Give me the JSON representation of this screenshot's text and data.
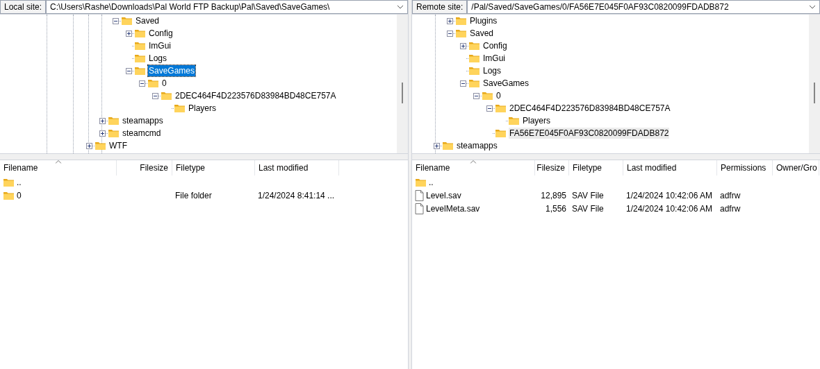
{
  "local": {
    "label": "Local site:",
    "path": "C:\\Users\\Rashe\\Downloads\\Pal World FTP Backup\\Pal\\Saved\\SaveGames\\",
    "tree": {
      "items": [
        {
          "children": [
            {
              "children": [
                {
                  "label": "Saved",
                  "expanded": true,
                  "selected": false,
                  "children": [
                    {
                      "label": "Config",
                      "expanded": false,
                      "selected": false
                    },
                    {
                      "label": "ImGui",
                      "selected": false
                    },
                    {
                      "label": "Logs",
                      "selected": false
                    },
                    {
                      "label": "SaveGames",
                      "expanded": true,
                      "selected": true,
                      "focused": true,
                      "children": [
                        {
                          "label": "0",
                          "expanded": true,
                          "selected": false,
                          "children": [
                            {
                              "label": "2DEC464F4D223576D83984BD48CE757A",
                              "expanded": true,
                              "selected": false,
                              "children": [
                                {
                                  "label": "Players",
                                  "selected": false
                                }
                              ]
                            }
                          ]
                        }
                      ]
                    }
                  ]
                }
              ]
            },
            {
              "label": "steamapps",
              "expanded": false,
              "selected": false
            },
            {
              "label": "steamcmd",
              "expanded": false,
              "selected": false
            }
          ]
        },
        {
          "label": "WTF",
          "expanded": false,
          "selected": false
        }
      ]
    },
    "columns": [
      {
        "label": "Filename",
        "sorted": true
      },
      {
        "label": "Filesize",
        "sorted": false
      },
      {
        "label": "Filetype",
        "sorted": false
      },
      {
        "label": "Last modified",
        "sorted": false
      }
    ],
    "rows": [
      {
        "kind": "folder",
        "name": ".."
      },
      {
        "kind": "folder",
        "name": "0",
        "type": "File folder",
        "modified": "1/24/2024 8:41:14 ..."
      }
    ]
  },
  "remote": {
    "label": "Remote site:",
    "path": "/Pal/Saved/SaveGames/0/FA56E7E045F0AF93C0820099FDADB872",
    "tree": {
      "items": [
        {
          "children": [
            {
              "label": "Plugins",
              "expanded": false,
              "selected": false
            },
            {
              "label": "Saved",
              "expanded": true,
              "selected": false,
              "children": [
                {
                  "label": "Config",
                  "expanded": false,
                  "selected": false
                },
                {
                  "label": "ImGui",
                  "selected": false
                },
                {
                  "label": "Logs",
                  "selected": false
                },
                {
                  "label": "SaveGames",
                  "expanded": true,
                  "selected": false,
                  "children": [
                    {
                      "label": "0",
                      "expanded": true,
                      "selected": false,
                      "children": [
                        {
                          "label": "2DEC464F4D223576D83984BD48CE757A",
                          "expanded": true,
                          "selected": false,
                          "children": [
                            {
                              "label": "Players",
                              "selected": false
                            }
                          ]
                        },
                        {
                          "label": "FA56E7E045F0AF93C0820099FDADB872",
                          "selected": true,
                          "focused": false
                        }
                      ]
                    }
                  ]
                }
              ]
            }
          ]
        },
        {
          "label": "steamapps",
          "expanded": false,
          "selected": false
        }
      ]
    },
    "columns": [
      {
        "label": "Filename",
        "sorted": true
      },
      {
        "label": "Filesize",
        "sorted": false
      },
      {
        "label": "Filetype",
        "sorted": false
      },
      {
        "label": "Last modified",
        "sorted": false
      },
      {
        "label": "Permissions",
        "sorted": false
      },
      {
        "label": "Owner/Gro",
        "sorted": false
      }
    ],
    "rows": [
      {
        "kind": "folder",
        "name": ".."
      },
      {
        "kind": "file",
        "name": "Level.sav",
        "size": "12,895",
        "type": "SAV File",
        "modified": "1/24/2024 10:42:06 AM",
        "permissions": "adfrw"
      },
      {
        "kind": "file",
        "name": "LevelMeta.sav",
        "size": "1,556",
        "type": "SAV File",
        "modified": "1/24/2024 10:42:06 AM",
        "permissions": "adfrw"
      }
    ]
  }
}
